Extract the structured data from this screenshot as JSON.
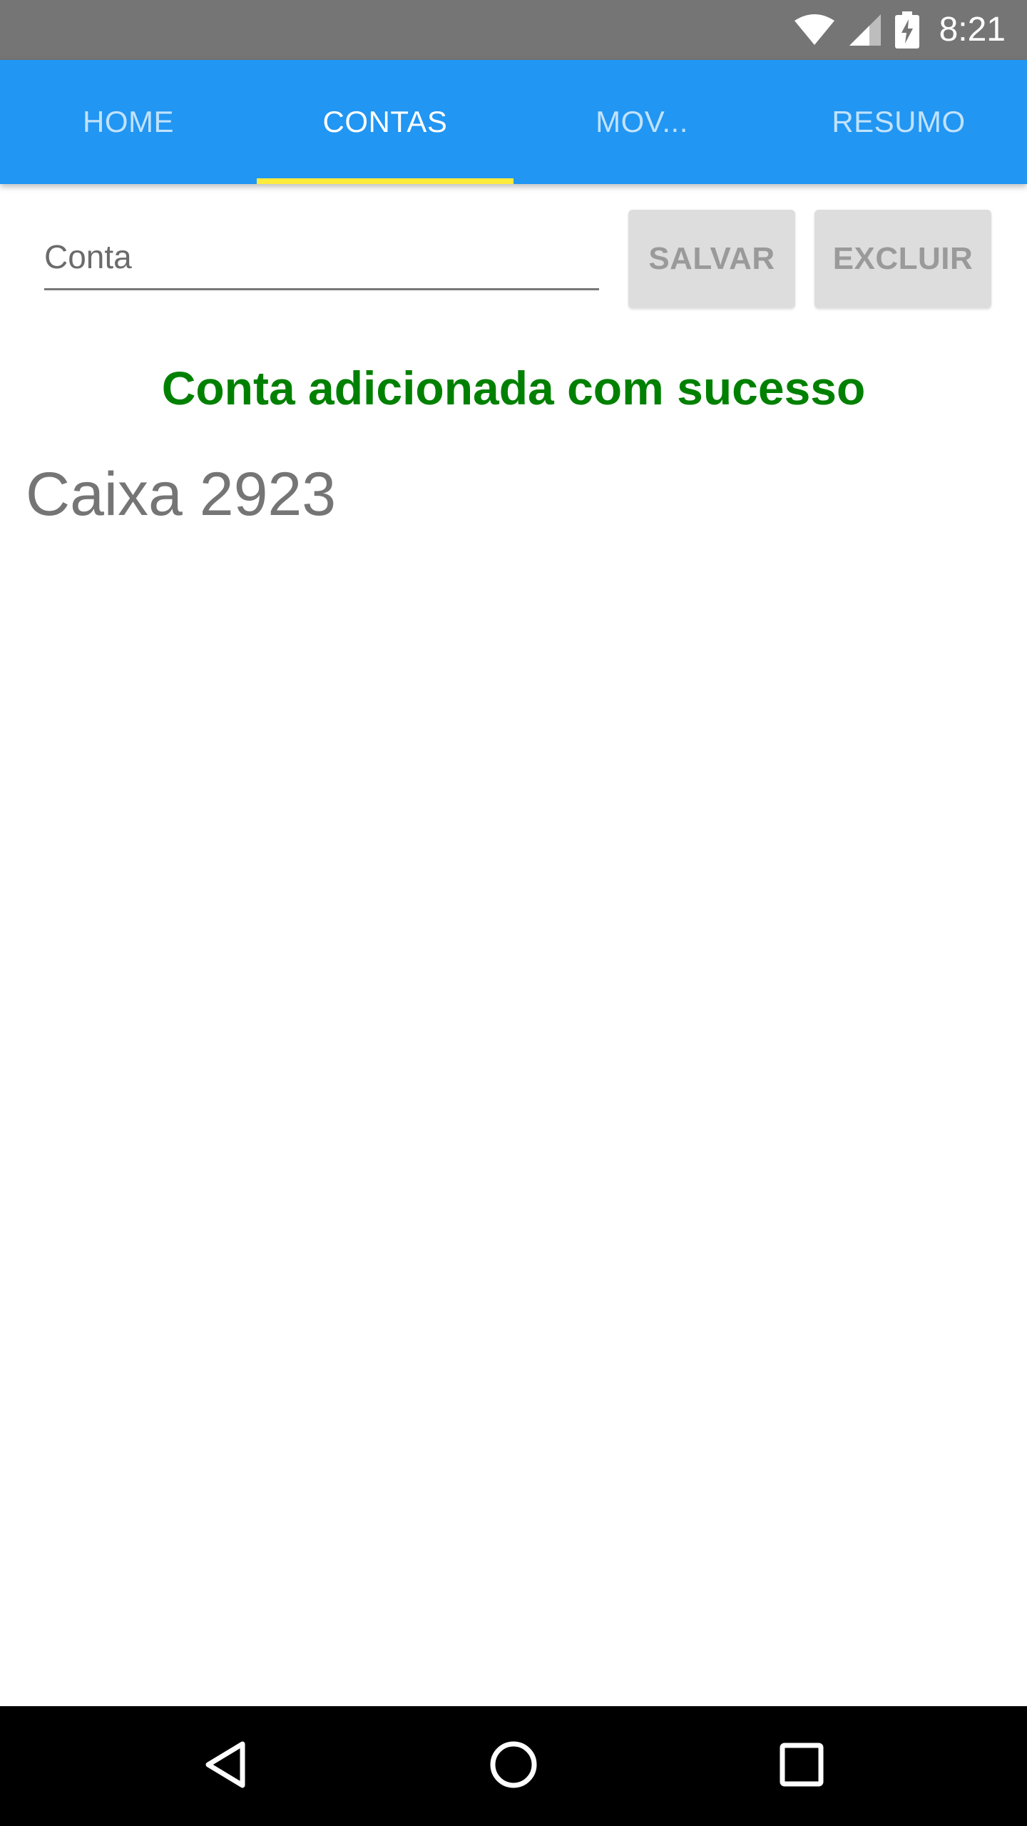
{
  "status_bar": {
    "time": "8:21",
    "icons": [
      "wifi-icon",
      "signal-icon",
      "battery-charging-icon"
    ]
  },
  "tabs": [
    {
      "label": "HOME",
      "active": false
    },
    {
      "label": "CONTAS",
      "active": true
    },
    {
      "label": "MOV...",
      "active": false
    },
    {
      "label": "RESUMO",
      "active": false
    }
  ],
  "form": {
    "conta_placeholder": "Conta",
    "conta_value": "",
    "salvar_label": "SALVAR",
    "excluir_label": "EXCLUIR"
  },
  "message": {
    "text": "Conta adicionada com sucesso",
    "color": "#008000"
  },
  "accounts": [
    {
      "name": "Caixa 2923"
    }
  ],
  "nav_bar": {
    "icons": [
      "back-icon",
      "home-icon",
      "recents-icon"
    ]
  },
  "colors": {
    "primary": "#2196F3",
    "tab_indicator": "#FFEB3B",
    "status_bar": "#757575",
    "button_disabled": "#DDDDDD"
  }
}
